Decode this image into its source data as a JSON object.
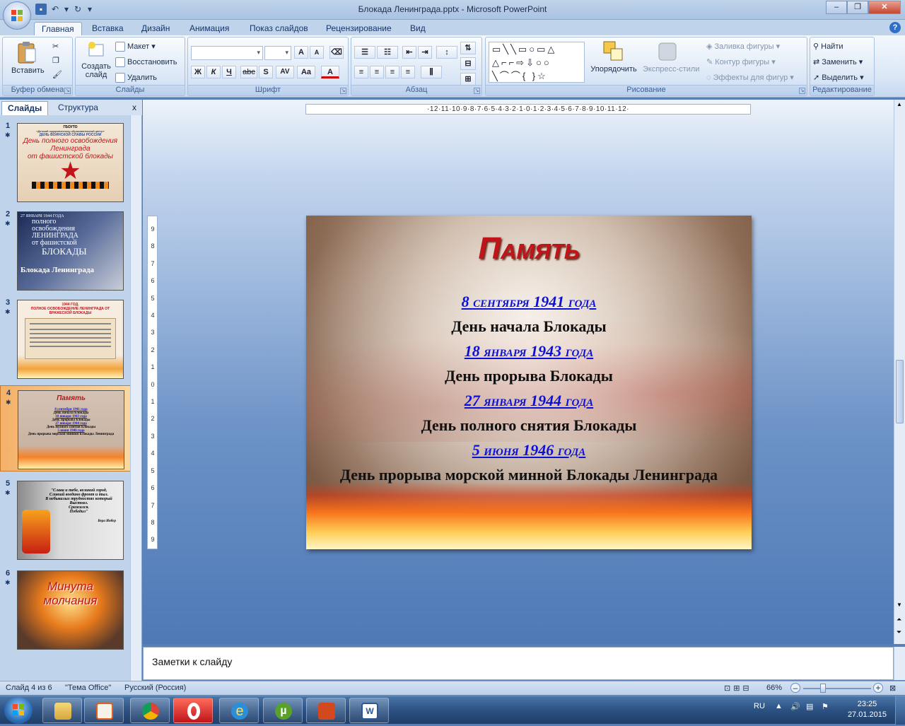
{
  "window": {
    "title": "Блокада Ленинграда.pptx - Microsoft PowerPoint",
    "quick_access": [
      "save-icon",
      "undo-icon",
      "redo-icon",
      "customize-icon"
    ]
  },
  "tabs": [
    {
      "label": "Главная",
      "active": true
    },
    {
      "label": "Вставка"
    },
    {
      "label": "Дизайн"
    },
    {
      "label": "Анимация"
    },
    {
      "label": "Показ слайдов"
    },
    {
      "label": "Рецензирование"
    },
    {
      "label": "Вид"
    }
  ],
  "ribbon": {
    "clipboard": {
      "label": "Буфер обмена",
      "paste": "Вставить"
    },
    "slides": {
      "label": "Слайды",
      "new_slide_1": "Создать",
      "new_slide_2": "слайд",
      "layout": "Макет",
      "reset": "Восстановить",
      "delete": "Удалить"
    },
    "font": {
      "label": "Шрифт",
      "bold": "Ж",
      "italic": "К",
      "underline": "Ч",
      "strike": "abc",
      "shadow": "S",
      "spacing": "AV",
      "case": "Aa",
      "color": "A",
      "grow": "A",
      "shrink": "A"
    },
    "paragraph": {
      "label": "Абзац"
    },
    "drawing": {
      "label": "Рисование",
      "arrange": "Упорядочить",
      "quick_styles": "Экспресс-стили",
      "fill": "Заливка фигуры",
      "outline": "Контур фигуры",
      "effects": "Эффекты для фигур"
    },
    "editing": {
      "label": "Редактирование",
      "find": "Найти",
      "replace": "Заменить",
      "select": "Выделить"
    }
  },
  "left_panel": {
    "tabs": [
      "Слайды",
      "Структура"
    ],
    "close": "x",
    "thumbnails": [
      {
        "num": "1",
        "lines": [
          "ГБОУТО",
          "«Детский оздоровительно-образовательный центр»",
          "ДЕНЬ ВОИНСКОЙ СЛАВЫ РОССИИ",
          "День полного освобождения",
          "Ленинграда",
          "от фашистской блокады"
        ]
      },
      {
        "num": "2",
        "lines": [
          "27 ЯНВАРЯ 1944 ГОДА",
          "полного",
          "освобождения",
          "ЛЕНИНГРАДА",
          "от фашистской",
          "БЛОКАДЫ",
          "Блокада Ленинграда"
        ]
      },
      {
        "num": "3",
        "lines": [
          "1944 ГОД.",
          "ПОЛНОЕ ОСВОБОЖДЕНИЕ ЛЕНИНГРАДА ОТ",
          "ВРАЖЕСКОЙ БЛОКАДЫ"
        ]
      },
      {
        "num": "4",
        "lines": [
          "Память",
          "8 сентября 1941 года",
          "День начала Блокады",
          "18 января 1943 года",
          "День прорыва Блокады",
          "27 января 1944 года",
          "День полного снятия Блокады",
          "5 июня 1946 года",
          "День прорыва морской минной Блокады Ленинграда"
        ],
        "selected": true
      },
      {
        "num": "5",
        "lines": [
          "\"Слава и тебе, великий город,",
          "Слившй воедино фронт и тыл.",
          "В небывалых трудностях который",
          "Выстоял.",
          "Сражался.",
          "Победил\"",
          "Вера Инбер"
        ]
      },
      {
        "num": "6",
        "lines": [
          "Минута",
          "молчания"
        ]
      }
    ]
  },
  "ruler": {
    "h": "·12·11·10·9·8·7·6·5·4·3·2·1·0·1·2·3·4·5·6·7·8·9·10·11·12·",
    "v": [
      "9",
      "8",
      "7",
      "6",
      "5",
      "4",
      "3",
      "2",
      "1",
      "0",
      "1",
      "2",
      "3",
      "4",
      "5",
      "6",
      "7",
      "8",
      "9"
    ]
  },
  "slide": {
    "title": "Память",
    "items": [
      {
        "date_a": "8 сентября",
        "date_b": "1941 года",
        "event": "День начала Блокады"
      },
      {
        "date_a": "18 января",
        "date_b": "1943 года",
        "event": "День прорыва Блокады"
      },
      {
        "date_a": "27 января",
        "date_b": "1944 года",
        "event": "День полного снятия Блокады"
      },
      {
        "date_a": "5 июня",
        "date_b": "1946 года",
        "event": "День прорыва морской минной Блокады Ленинграда"
      }
    ]
  },
  "notes": {
    "placeholder": "Заметки к слайду"
  },
  "status": {
    "slide": "Слайд 4 из 6",
    "theme": "\"Тема Office\"",
    "lang": "Русский (Россия)",
    "zoom": "66%",
    "zoom_level_percent": 66
  },
  "taskbar": {
    "lang": "RU",
    "time": "23:25",
    "date": "27.01.2015",
    "apps": [
      "explorer-icon",
      "media-player-icon",
      "chrome-icon",
      "opera-icon",
      "ie-icon",
      "utorrent-icon",
      "powerpoint-icon",
      "word-icon"
    ]
  },
  "colors": {
    "accent": "#c0141a",
    "date_link": "#0b10d9",
    "ribbon": "#dbe7f6",
    "workspace": "#5a7fb5"
  }
}
